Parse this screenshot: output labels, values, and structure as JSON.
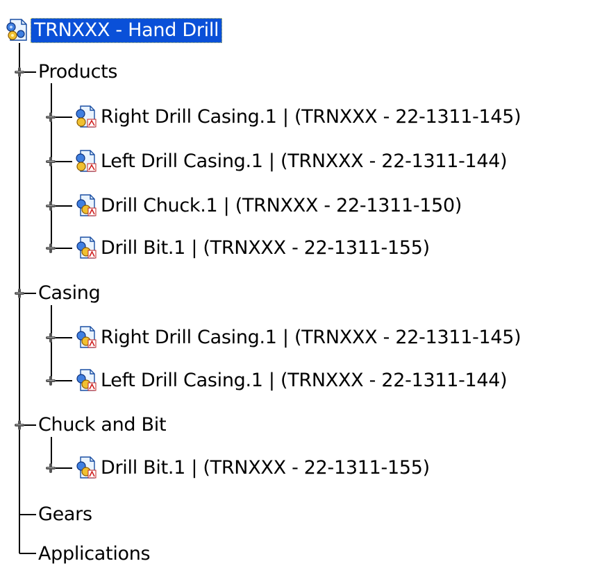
{
  "root": {
    "label": "TRNXXX - Hand Drill",
    "icon": "product-icon"
  },
  "groups": [
    {
      "label": "Products",
      "state": "expanded",
      "children": [
        {
          "label": "Right Drill Casing.1 | (TRNXXX - 22-1311-145)",
          "icon": "product-icon"
        },
        {
          "label": "Left Drill Casing.1 | (TRNXXX - 22-1311-144)",
          "icon": "product-icon"
        },
        {
          "label": "Drill Chuck.1 | (TRNXXX - 22-1311-150)",
          "icon": "part-icon"
        },
        {
          "label": "Drill Bit.1 | (TRNXXX - 22-1311-155)",
          "icon": "part-icon"
        }
      ]
    },
    {
      "label": "Casing",
      "state": "expanded",
      "children": [
        {
          "label": "Right Drill Casing.1 | (TRNXXX - 22-1311-145)",
          "icon": "part-icon"
        },
        {
          "label": "Left Drill Casing.1 | (TRNXXX - 22-1311-144)",
          "icon": "part-icon"
        }
      ]
    },
    {
      "label": "Chuck and Bit",
      "state": "expanded",
      "children": [
        {
          "label": "Drill Bit.1 | (TRNXXX - 22-1311-155)",
          "icon": "part-icon"
        }
      ]
    },
    {
      "label": "Gears",
      "state": "leaf",
      "children": []
    },
    {
      "label": "Applications",
      "state": "leaf",
      "children": []
    }
  ],
  "colors": {
    "selection": "#0a50d8",
    "selection_text": "#ffffff",
    "tree_line": "#000000"
  }
}
